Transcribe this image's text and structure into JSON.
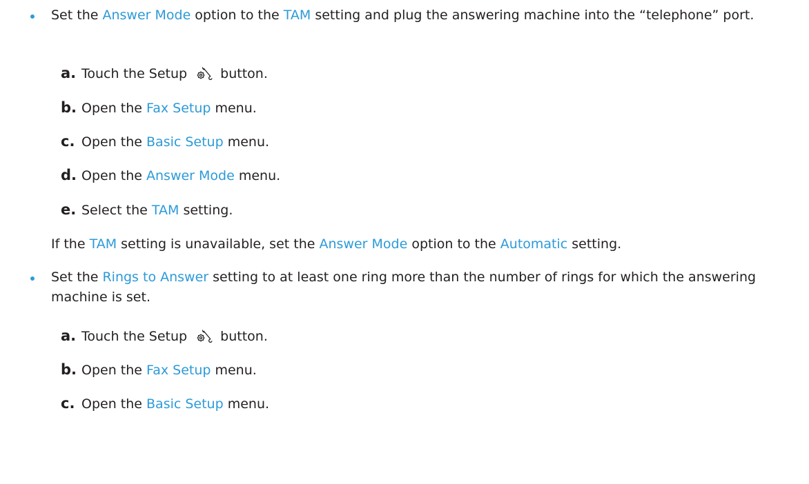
{
  "bullets": [
    {
      "parts": [
        {
          "text": "Set the ",
          "hl": false
        },
        {
          "text": "Answer Mode",
          "hl": true
        },
        {
          "text": " option to the ",
          "hl": false
        },
        {
          "text": "TAM",
          "hl": true
        },
        {
          "text": " setting and plug the answering machine into the “telephone” port.",
          "hl": false
        }
      ],
      "steps": [
        {
          "letter": "a.",
          "parts": [
            {
              "text": "Touch the Setup ",
              "hl": false
            },
            {
              "icon": "setup-wrench-gear-icon"
            },
            {
              "text": " button.",
              "hl": false
            }
          ]
        },
        {
          "letter": "b.",
          "parts": [
            {
              "text": "Open the ",
              "hl": false
            },
            {
              "text": "Fax Setup",
              "hl": true
            },
            {
              "text": " menu.",
              "hl": false
            }
          ]
        },
        {
          "letter": "c.",
          "parts": [
            {
              "text": "Open the ",
              "hl": false
            },
            {
              "text": "Basic Setup",
              "hl": true
            },
            {
              "text": " menu.",
              "hl": false
            }
          ]
        },
        {
          "letter": "d.",
          "parts": [
            {
              "text": "Open the ",
              "hl": false
            },
            {
              "text": "Answer Mode",
              "hl": true
            },
            {
              "text": " menu.",
              "hl": false
            }
          ]
        },
        {
          "letter": "e.",
          "parts": [
            {
              "text": "Select the ",
              "hl": false
            },
            {
              "text": "TAM",
              "hl": true
            },
            {
              "text": " setting.",
              "hl": false
            }
          ]
        }
      ],
      "note": [
        {
          "text": "If the ",
          "hl": false
        },
        {
          "text": "TAM",
          "hl": true
        },
        {
          "text": " setting is unavailable, set the ",
          "hl": false
        },
        {
          "text": "Answer Mode",
          "hl": true
        },
        {
          "text": " option to the ",
          "hl": false
        },
        {
          "text": "Automatic",
          "hl": true
        },
        {
          "text": " setting.",
          "hl": false
        }
      ]
    },
    {
      "parts": [
        {
          "text": "Set the ",
          "hl": false
        },
        {
          "text": "Rings to Answer",
          "hl": true
        },
        {
          "text": " setting to at least one ring more than the number of rings for which the answering machine is set.",
          "hl": false
        }
      ],
      "steps": [
        {
          "letter": "a.",
          "parts": [
            {
              "text": "Touch the Setup ",
              "hl": false
            },
            {
              "icon": "setup-wrench-gear-icon"
            },
            {
              "text": " button.",
              "hl": false
            }
          ]
        },
        {
          "letter": "b.",
          "parts": [
            {
              "text": "Open the ",
              "hl": false
            },
            {
              "text": "Fax Setup",
              "hl": true
            },
            {
              "text": " menu.",
              "hl": false
            }
          ]
        },
        {
          "letter": "c.",
          "parts": [
            {
              "text": "Open the ",
              "hl": false
            },
            {
              "text": "Basic Setup",
              "hl": true
            },
            {
              "text": " menu.",
              "hl": false
            }
          ]
        }
      ]
    }
  ],
  "colors": {
    "link": "#2c9ad8",
    "text": "#231f20",
    "bullet": "#2c9ad8"
  }
}
